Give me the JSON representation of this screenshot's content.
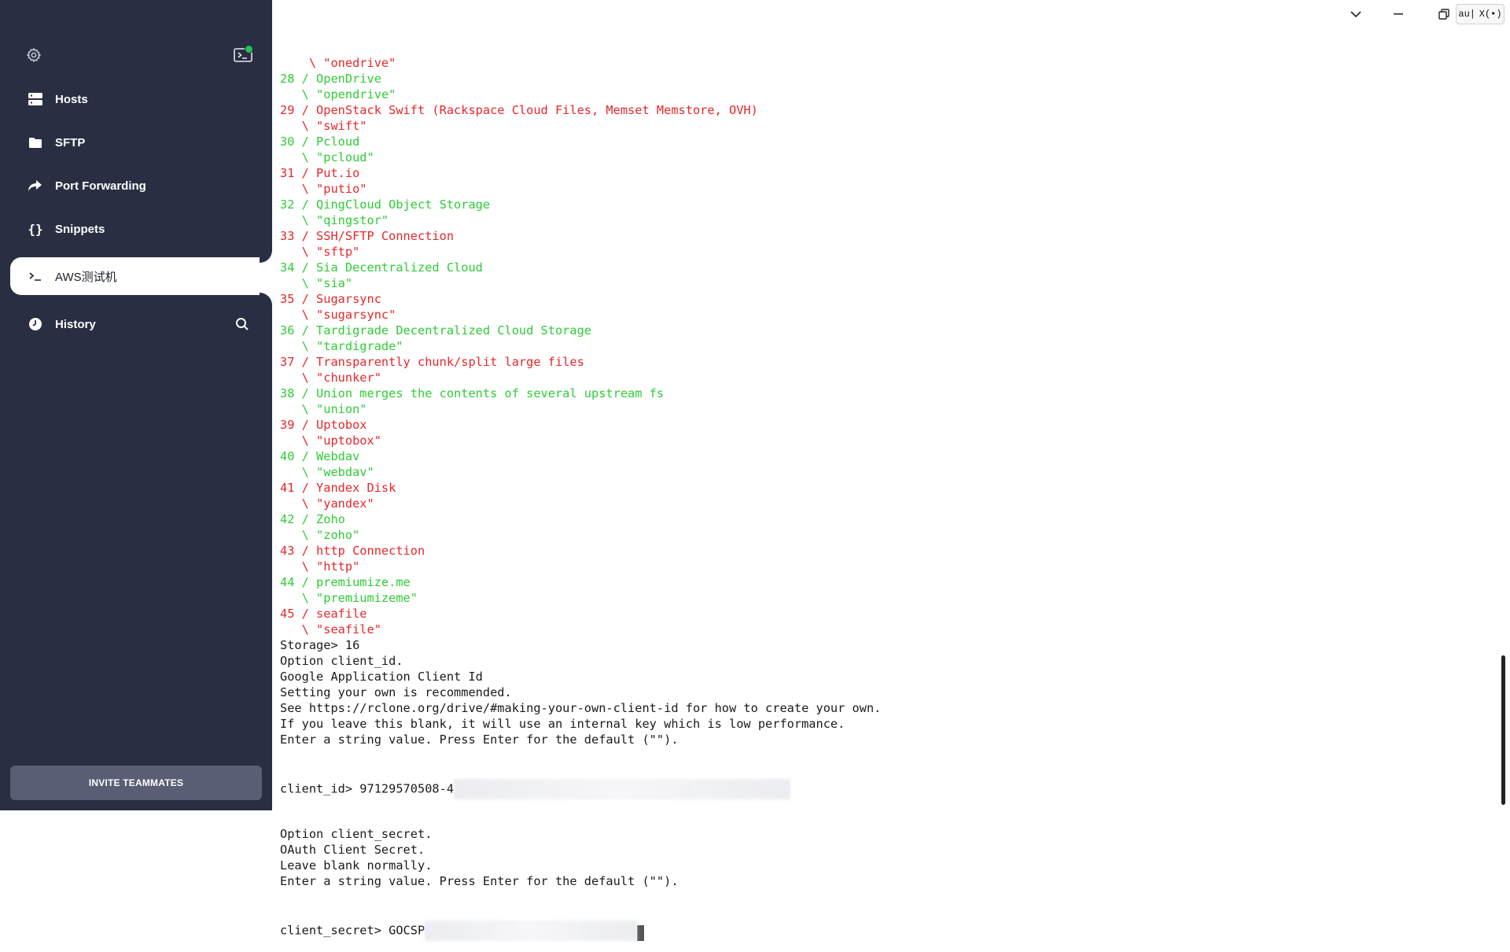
{
  "sidebar": {
    "settings_icon": "gear-icon",
    "terminal_icon": "terminal-icon",
    "nav": [
      {
        "label": "Hosts",
        "icon": "server-icon"
      },
      {
        "label": "SFTP",
        "icon": "folder-icon"
      },
      {
        "label": "Port Forwarding",
        "icon": "forward-arrow-icon"
      },
      {
        "label": "Snippets",
        "icon": "braces-icon"
      },
      {
        "label": "AWS测试机",
        "icon": "prompt-icon"
      },
      {
        "label": "History",
        "icon": "clock-icon"
      }
    ],
    "invite_label": "INVITE TEAMMATES"
  },
  "window": {
    "badge_left": "au|",
    "badge_right": "X(•)"
  },
  "terminal": {
    "lines": [
      {
        "text": "    \\ \"onedrive\"",
        "color": "red"
      },
      {
        "text": "28 / OpenDrive",
        "color": "green"
      },
      {
        "text": "   \\ \"opendrive\"",
        "color": "green"
      },
      {
        "text": "29 / OpenStack Swift (Rackspace Cloud Files, Memset Memstore, OVH)",
        "color": "red"
      },
      {
        "text": "   \\ \"swift\"",
        "color": "red"
      },
      {
        "text": "30 / Pcloud",
        "color": "green"
      },
      {
        "text": "   \\ \"pcloud\"",
        "color": "green"
      },
      {
        "text": "31 / Put.io",
        "color": "red"
      },
      {
        "text": "   \\ \"putio\"",
        "color": "red"
      },
      {
        "text": "32 / QingCloud Object Storage",
        "color": "green"
      },
      {
        "text": "   \\ \"qingstor\"",
        "color": "green"
      },
      {
        "text": "33 / SSH/SFTP Connection",
        "color": "red"
      },
      {
        "text": "   \\ \"sftp\"",
        "color": "red"
      },
      {
        "text": "34 / Sia Decentralized Cloud",
        "color": "green"
      },
      {
        "text": "   \\ \"sia\"",
        "color": "green"
      },
      {
        "text": "35 / Sugarsync",
        "color": "red"
      },
      {
        "text": "   \\ \"sugarsync\"",
        "color": "red"
      },
      {
        "text": "36 / Tardigrade Decentralized Cloud Storage",
        "color": "green"
      },
      {
        "text": "   \\ \"tardigrade\"",
        "color": "green"
      },
      {
        "text": "37 / Transparently chunk/split large files",
        "color": "red"
      },
      {
        "text": "   \\ \"chunker\"",
        "color": "red"
      },
      {
        "text": "38 / Union merges the contents of several upstream fs",
        "color": "green"
      },
      {
        "text": "   \\ \"union\"",
        "color": "green"
      },
      {
        "text": "39 / Uptobox",
        "color": "red"
      },
      {
        "text": "   \\ \"uptobox\"",
        "color": "red"
      },
      {
        "text": "40 / Webdav",
        "color": "green"
      },
      {
        "text": "   \\ \"webdav\"",
        "color": "green"
      },
      {
        "text": "41 / Yandex Disk",
        "color": "red"
      },
      {
        "text": "   \\ \"yandex\"",
        "color": "red"
      },
      {
        "text": "42 / Zoho",
        "color": "green"
      },
      {
        "text": "   \\ \"zoho\"",
        "color": "green"
      },
      {
        "text": "43 / http Connection",
        "color": "red"
      },
      {
        "text": "   \\ \"http\"",
        "color": "red"
      },
      {
        "text": "44 / premiumize.me",
        "color": "green"
      },
      {
        "text": "   \\ \"premiumizeme\"",
        "color": "green"
      },
      {
        "text": "45 / seafile",
        "color": "red"
      },
      {
        "text": "   \\ \"seafile\"",
        "color": "red"
      },
      {
        "text": "Storage> 16",
        "color": "plain"
      },
      {
        "text": "Option client_id.",
        "color": "plain"
      },
      {
        "text": "Google Application Client Id",
        "color": "plain"
      },
      {
        "text": "Setting your own is recommended.",
        "color": "plain"
      },
      {
        "text": "See https://rclone.org/drive/#making-your-own-client-id for how to create your own.",
        "color": "plain"
      },
      {
        "text": "If you leave this blank, it will use an internal key which is low performance.",
        "color": "plain"
      },
      {
        "text": "Enter a string value. Press Enter for the default (\"\").",
        "color": "plain"
      }
    ],
    "client_id_prompt": "client_id> 97129570508-4",
    "lines_after": [
      {
        "text": "Option client_secret.",
        "color": "plain"
      },
      {
        "text": "OAuth Client Secret.",
        "color": "plain"
      },
      {
        "text": "Leave blank normally.",
        "color": "plain"
      },
      {
        "text": "Enter a string value. Press Enter for the default (\"\").",
        "color": "plain"
      }
    ],
    "client_secret_prompt": "client_secret> GOCSP"
  }
}
